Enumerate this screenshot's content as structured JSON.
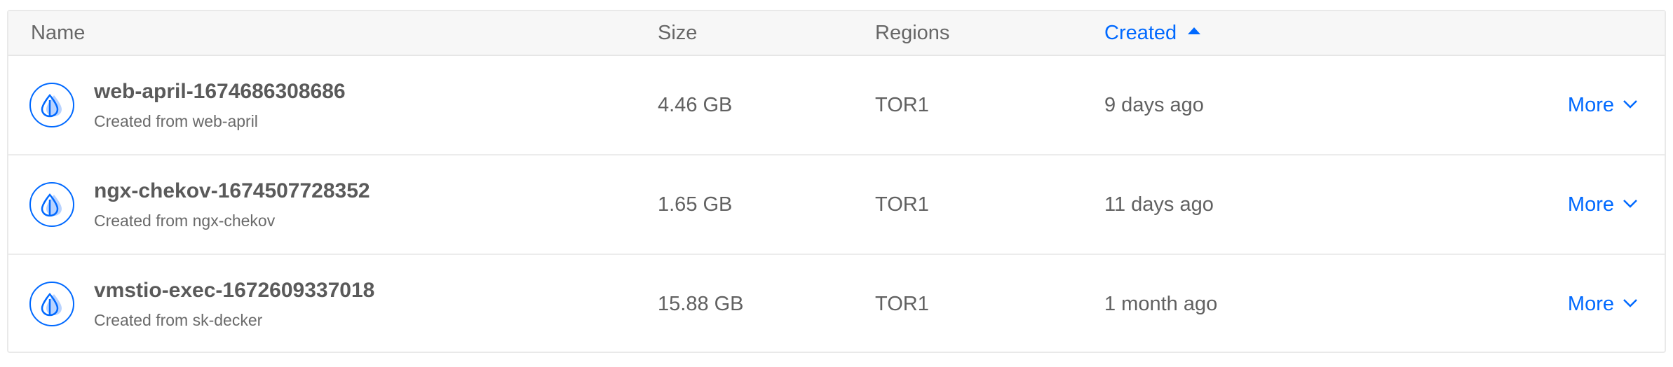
{
  "table": {
    "columns": {
      "name": "Name",
      "size": "Size",
      "regions": "Regions",
      "created": "Created"
    },
    "sort": {
      "column": "created",
      "direction": "ascending",
      "icon": "sort-up-icon"
    },
    "rows": [
      {
        "name": "web-april-1674686308686",
        "subtitle": "Created from web-april",
        "size": "4.46 GB",
        "region": "TOR1",
        "created": "9 days ago",
        "more_label": "More",
        "icon": "droplet-icon"
      },
      {
        "name": "ngx-chekov-1674507728352",
        "subtitle": "Created from ngx-chekov",
        "size": "1.65 GB",
        "region": "TOR1",
        "created": "11 days ago",
        "more_label": "More",
        "icon": "droplet-icon"
      },
      {
        "name": "vmstio-exec-1672609337018",
        "subtitle": "Created from sk-decker",
        "size": "15.88 GB",
        "region": "TOR1",
        "created": "1 month ago",
        "more_label": "More",
        "icon": "droplet-icon"
      }
    ]
  },
  "colors": {
    "accent": "#0069ff",
    "header_bg": "#f7f7f7",
    "border": "#e9e9e9",
    "text": "#5b5b5b"
  }
}
